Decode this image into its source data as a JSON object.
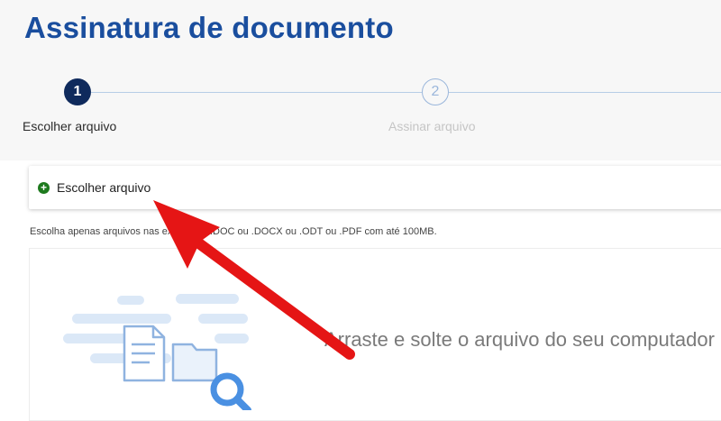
{
  "page": {
    "title": "Assinatura de documento"
  },
  "stepper": {
    "steps": [
      {
        "number": "1",
        "label": "Escolher arquivo",
        "state": "active"
      },
      {
        "number": "2",
        "label": "Assinar arquivo",
        "state": "inactive"
      }
    ]
  },
  "upload": {
    "choose_button_label": "Escolher arquivo",
    "hint": "Escolha apenas arquivos nas extensões .DOC ou .DOCX ou .ODT ou .PDF com até 100MB.",
    "dropzone_text": "Arraste e solte o arquivo do seu computador"
  },
  "colors": {
    "title": "#1a4e9e",
    "step_active": "#0f2a5c",
    "step_inactive": "#9ab6db",
    "add_icon": "#1e7a1e",
    "arrow": "#e51515"
  },
  "icons": {
    "add": "plus-circle-icon",
    "illustration": "document-folder-search-illustration",
    "annotation": "red-pointer-arrow"
  }
}
